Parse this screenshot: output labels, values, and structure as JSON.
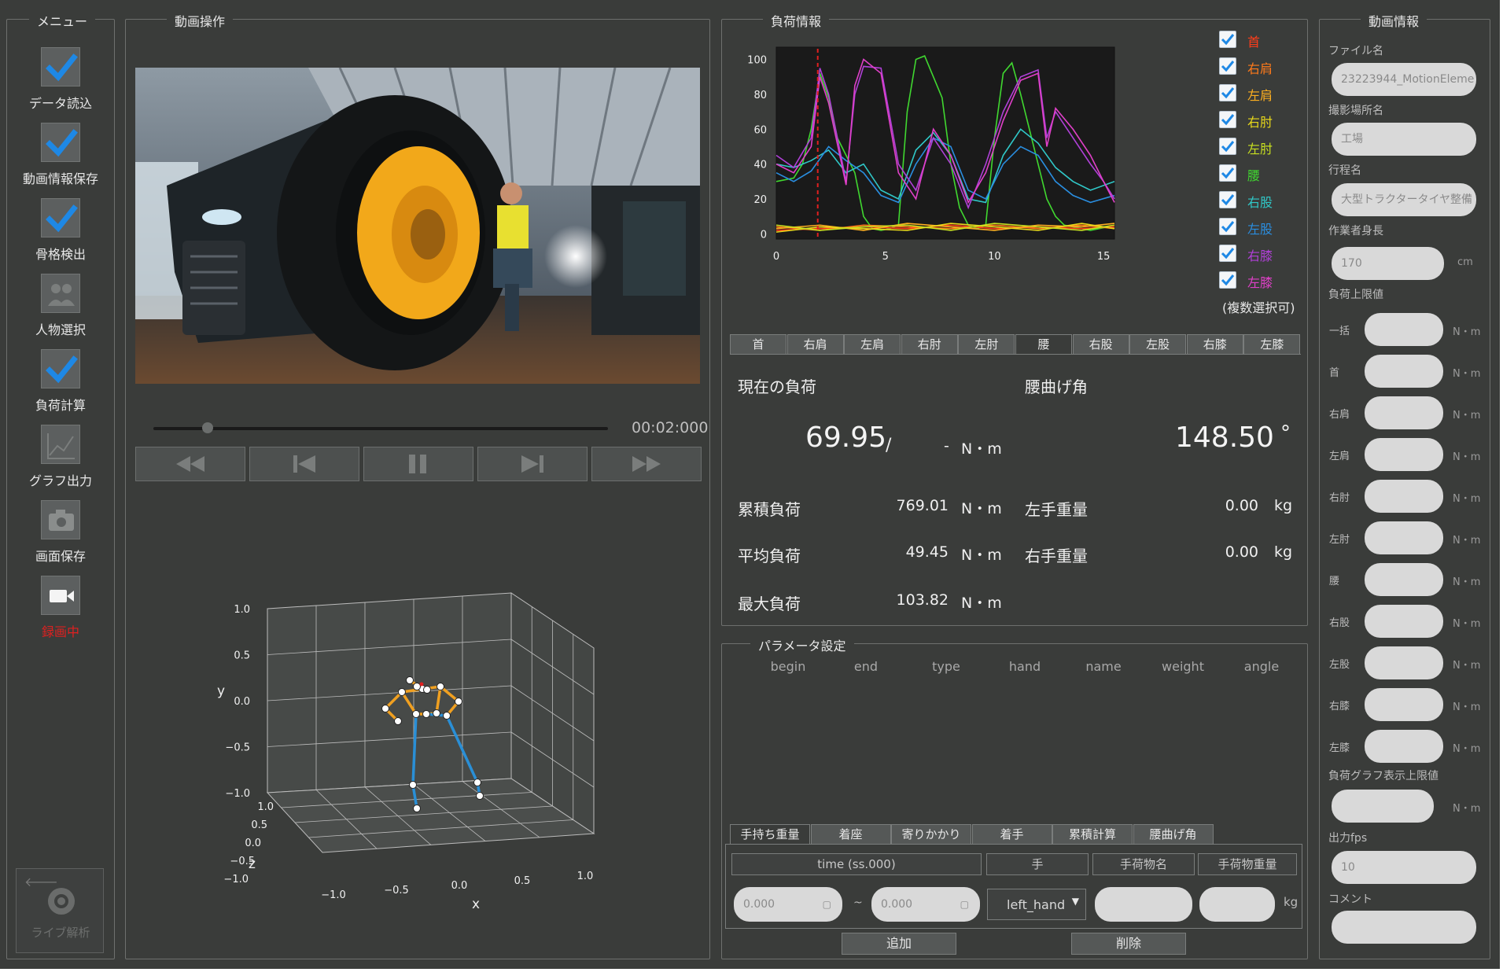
{
  "menu": {
    "title": "メニュー",
    "items": [
      {
        "label": "データ読込",
        "state": "checked"
      },
      {
        "label": "動画情報保存",
        "state": "checked"
      },
      {
        "label": "骨格検出",
        "state": "checked"
      },
      {
        "label": "人物選択",
        "state": "unchecked"
      },
      {
        "label": "負荷計算",
        "state": "checked"
      },
      {
        "label": "グラフ出力",
        "state": "unchecked"
      },
      {
        "label": "画面保存",
        "state": "unchecked"
      },
      {
        "label": "録画中",
        "state": "recording"
      }
    ],
    "live_label": "ライブ解析"
  },
  "video": {
    "title": "動画操作",
    "time": "00:02:000",
    "progress": 0.12
  },
  "pose3d": {
    "y_ticks": [
      "1.0",
      "0.5",
      "0.0",
      "−0.5",
      "−1.0"
    ],
    "z_ticks": [
      "1.0",
      "0.5",
      "0.0",
      "−0.5",
      "−1.0"
    ],
    "x_ticks": [
      "−1.0",
      "−0.5",
      "0.0",
      "0.5",
      "1.0"
    ],
    "ylabel": "y",
    "zlabel": "z",
    "xlabel": "x",
    "colors": {
      "upper": "#f0a020",
      "lower": "#2a8fd6"
    }
  },
  "load": {
    "title": "負荷情報",
    "legend": [
      {
        "label": "首",
        "color": "#ff3d1a"
      },
      {
        "label": "右肩",
        "color": "#ff7a1a"
      },
      {
        "label": "左肩",
        "color": "#ffb020"
      },
      {
        "label": "右肘",
        "color": "#e8d81a"
      },
      {
        "label": "左肘",
        "color": "#c8e020"
      },
      {
        "label": "腰",
        "color": "#40d830"
      },
      {
        "label": "右股",
        "color": "#30c8c8"
      },
      {
        "label": "左股",
        "color": "#2a8ee0"
      },
      {
        "label": "右膝",
        "color": "#b040d8"
      },
      {
        "label": "左膝",
        "color": "#e040c8"
      }
    ],
    "multi_note": "(複数選択可)",
    "tabs": [
      "首",
      "右肩",
      "左肩",
      "右肘",
      "左肘",
      "腰",
      "右股",
      "左股",
      "右膝",
      "左膝"
    ],
    "active_tab": 5,
    "current_label": "現在の負荷",
    "current_value": "69.95",
    "slash": "/",
    "limit_value": "-",
    "unit_nm": "N・m",
    "bend_label": "腰曲げ角",
    "bend_value": "148.50",
    "deg": "°",
    "cum_label": "累積負荷",
    "cum_value": "769.01",
    "avg_label": "平均負荷",
    "avg_value": "49.45",
    "max_label": "最大負荷",
    "max_value": "103.82",
    "lw_label": "左手重量",
    "lw_value": "0.00",
    "rw_label": "右手重量",
    "rw_value": "0.00",
    "kg": "kg"
  },
  "chart_data": {
    "type": "line",
    "xlim": [
      0,
      15.5
    ],
    "ylim": [
      -3,
      107
    ],
    "xticks": [
      "0",
      "5",
      "10",
      "15"
    ],
    "yticks": [
      "0",
      "20",
      "40",
      "60",
      "80",
      "100"
    ],
    "cursor_x": 1.9,
    "series": [
      {
        "name": "腰",
        "color": "#40d830",
        "x": [
          0,
          0.8,
          1.2,
          1.6,
          2.0,
          2.4,
          2.8,
          3.2,
          3.6,
          4.0,
          4.4,
          4.8,
          5.2,
          5.6,
          6.0,
          6.4,
          6.8,
          7.2,
          7.6,
          8.0,
          8.4,
          8.8,
          9.2,
          9.6,
          10.0,
          10.4,
          10.8,
          11.2,
          11.6,
          12.0,
          12.4,
          12.8,
          13.2,
          13.6,
          14.0,
          14.4,
          14.8,
          15.2,
          15.5
        ],
        "y": [
          30,
          32,
          40,
          60,
          92,
          78,
          55,
          45,
          35,
          10,
          3,
          2,
          3,
          5,
          70,
          100,
          102,
          90,
          78,
          40,
          15,
          5,
          3,
          5,
          55,
          92,
          98,
          80,
          60,
          40,
          20,
          10,
          5,
          4,
          3,
          2,
          3,
          4,
          3
        ]
      },
      {
        "name": "右股",
        "color": "#30c8c8",
        "x": [
          0,
          0.8,
          1.6,
          2.4,
          3.2,
          4.0,
          4.8,
          5.6,
          6.4,
          7.2,
          8.0,
          8.8,
          9.6,
          10.4,
          11.2,
          12.0,
          12.8,
          13.6,
          14.4,
          15.5
        ],
        "y": [
          40,
          38,
          42,
          48,
          35,
          40,
          25,
          20,
          48,
          58,
          45,
          20,
          18,
          45,
          60,
          52,
          38,
          30,
          25,
          30
        ]
      },
      {
        "name": "左股",
        "color": "#2a8ee0",
        "x": [
          0,
          0.8,
          1.6,
          2.4,
          3.2,
          4.0,
          4.8,
          5.6,
          6.4,
          7.2,
          8.0,
          8.8,
          9.6,
          10.4,
          11.2,
          12.0,
          12.8,
          13.6,
          14.4,
          15.5
        ],
        "y": [
          35,
          30,
          36,
          50,
          42,
          35,
          22,
          18,
          40,
          55,
          50,
          25,
          20,
          40,
          50,
          45,
          30,
          22,
          18,
          22
        ]
      },
      {
        "name": "右膝",
        "color": "#b040d8",
        "x": [
          0,
          0.8,
          1.6,
          2.0,
          2.4,
          3.2,
          3.6,
          4.0,
          4.8,
          5.6,
          6.4,
          7.2,
          8.0,
          8.8,
          9.6,
          10.4,
          11.2,
          12.0,
          12.4,
          12.8,
          13.6,
          14.4,
          15.0,
          15.5
        ],
        "y": [
          45,
          38,
          55,
          95,
          80,
          30,
          80,
          96,
          95,
          40,
          25,
          55,
          40,
          15,
          40,
          70,
          90,
          94,
          55,
          70,
          55,
          40,
          30,
          20
        ]
      },
      {
        "name": "左膝",
        "color": "#e040c8",
        "x": [
          0,
          0.8,
          1.6,
          2.0,
          2.4,
          3.2,
          3.6,
          4.0,
          4.8,
          5.6,
          6.4,
          7.2,
          8.0,
          8.8,
          9.6,
          10.4,
          11.2,
          12.0,
          12.4,
          12.8,
          13.6,
          14.4,
          15.0,
          15.5
        ],
        "y": [
          40,
          35,
          50,
          90,
          75,
          28,
          85,
          100,
          92,
          35,
          20,
          60,
          45,
          18,
          35,
          65,
          88,
          92,
          50,
          72,
          60,
          45,
          30,
          18
        ]
      },
      {
        "name": "首",
        "color": "#ff3d1a",
        "x": [
          0,
          2,
          4,
          6,
          8,
          10,
          12,
          14,
          15.5
        ],
        "y": [
          2,
          3,
          4,
          3,
          5,
          3,
          4,
          3,
          4
        ]
      },
      {
        "name": "右肩",
        "color": "#ff7a1a",
        "x": [
          0,
          2,
          4,
          6,
          8,
          10,
          12,
          14,
          15.5
        ],
        "y": [
          4,
          2,
          5,
          4,
          3,
          5,
          3,
          5,
          3
        ]
      },
      {
        "name": "左肩",
        "color": "#ffb020",
        "x": [
          0,
          2,
          4,
          6,
          8,
          10,
          12,
          14,
          15.5
        ],
        "y": [
          3,
          5,
          2,
          6,
          4,
          2,
          5,
          4,
          6
        ]
      },
      {
        "name": "右肘",
        "color": "#e8d81a",
        "x": [
          0,
          2,
          4,
          6,
          8,
          10,
          12,
          14,
          15.5
        ],
        "y": [
          1,
          4,
          3,
          2,
          6,
          4,
          2,
          6,
          3
        ]
      },
      {
        "name": "左肘",
        "color": "#c8e020",
        "x": [
          0,
          2,
          4,
          6,
          8,
          10,
          12,
          14,
          15.5
        ],
        "y": [
          5,
          2,
          4,
          5,
          2,
          6,
          4,
          2,
          5
        ]
      }
    ]
  },
  "params": {
    "title": "パラメータ設定",
    "columns": [
      "begin",
      "end",
      "type",
      "hand",
      "name",
      "weight",
      "angle"
    ],
    "tabs": [
      "手持ち重量",
      "着座",
      "寄りかかり",
      "着手",
      "累積計算",
      "腰曲げ角"
    ],
    "headers": [
      "time (ss.000)",
      "手",
      "手荷物名",
      "手荷物重量"
    ],
    "begin_value": "0.000",
    "end_value": "0.000",
    "tilde": "~",
    "hand_value": "left_hand",
    "kg": "kg",
    "add_label": "追加",
    "delete_label": "削除"
  },
  "info": {
    "title": "動画情報",
    "file_label": "ファイル名",
    "file_value": "23223944_MotionEleme",
    "place_label": "撮影場所名",
    "place_value": "工場",
    "process_label": "行程名",
    "process_value": "大型トラクタータイヤ整備",
    "height_label": "作業者身長",
    "height_value": "170",
    "cm": "cm",
    "limit_label": "負荷上限値",
    "limit_rows": [
      "一括",
      "首",
      "右肩",
      "左肩",
      "右肘",
      "左肘",
      "腰",
      "右股",
      "左股",
      "右膝",
      "左膝"
    ],
    "nm": "N・m",
    "graph_limit_label": "負荷グラフ表示上限値",
    "fps_label": "出力fps",
    "fps_value": "10",
    "comment_label": "コメント"
  }
}
